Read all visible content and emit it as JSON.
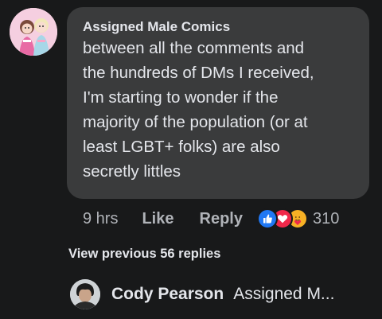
{
  "comment": {
    "avatar_icon": "comic-characters-avatar-icon",
    "author": "Assigned Male Comics",
    "lines": [
      "between all the comments and",
      "the hundreds of DMs I received,",
      "I'm starting to wonder if the",
      "majority of the population (or at",
      "least LGBT+ folks) are also",
      "secretly littles"
    ],
    "time": "9 hrs",
    "like_label": "Like",
    "reply_label": "Reply",
    "reactions": {
      "icons": [
        "like-reaction-icon",
        "love-reaction-icon",
        "care-reaction-icon"
      ],
      "count": "310"
    }
  },
  "replies": {
    "view_previous_label": "View previous 56 replies",
    "latest": {
      "avatar_icon": "user-photo-avatar-icon",
      "author": "Cody Pearson",
      "preview": "Assigned M..."
    }
  },
  "colors": {
    "background": "#18191a",
    "bubble": "#3a3b3c",
    "primary_text": "#e4e6eb",
    "secondary_text": "#b0b3b8",
    "like_blue": "#2078f4",
    "love_red": "#f0284a",
    "care_yellow": "#f7b125"
  }
}
